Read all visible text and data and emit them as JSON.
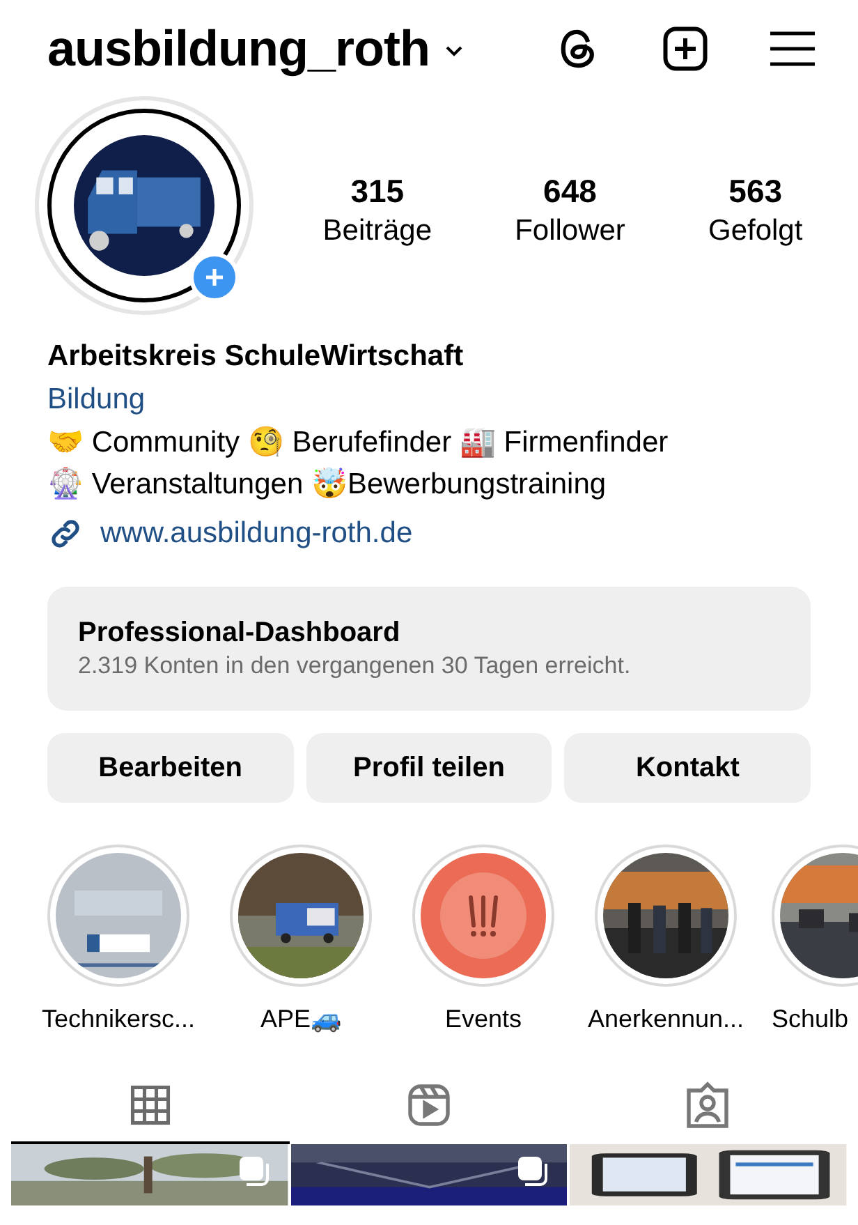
{
  "header": {
    "username": "ausbildung_roth"
  },
  "profile": {
    "avatar": {
      "kind": "picture"
    },
    "stats": [
      {
        "value": "315",
        "label": "Beiträge"
      },
      {
        "value": "648",
        "label": "Follower"
      },
      {
        "value": "563",
        "label": "Gefolgt"
      }
    ]
  },
  "bio": {
    "name": "Arbeitskreis SchuleWirtschaft",
    "category": "Bildung",
    "lines": [
      "🤝 Community 🧐 Berufefinder 🏭 Firmenfinder",
      "🎡 Veranstaltungen 🤯Bewerbungstraining"
    ],
    "link": "www.ausbildung-roth.de"
  },
  "dashboard": {
    "title": "Professional-Dashboard",
    "subtitle": "2.319 Konten in den vergangenen 30 Tagen erreicht."
  },
  "buttons": [
    "Bearbeiten",
    "Profil teilen",
    "Kontakt"
  ],
  "highlights": [
    {
      "kind": "picture",
      "label": "Technikersc..."
    },
    {
      "kind": "picture",
      "label": "APE🚙"
    },
    {
      "kind": "icon",
      "label": "Events"
    },
    {
      "kind": "picture",
      "label": "Anerkennun..."
    },
    {
      "kind": "picture",
      "label": "Schulb"
    }
  ],
  "tabs": [
    {
      "kind": "grid",
      "selected": true
    },
    {
      "kind": "reels",
      "selected": false
    },
    {
      "kind": "tagged",
      "selected": false
    }
  ],
  "posts": [
    {
      "kind": "picture",
      "multiple": true
    },
    {
      "kind": "picture",
      "multiple": true
    },
    {
      "kind": "picture",
      "multiple": false
    }
  ]
}
